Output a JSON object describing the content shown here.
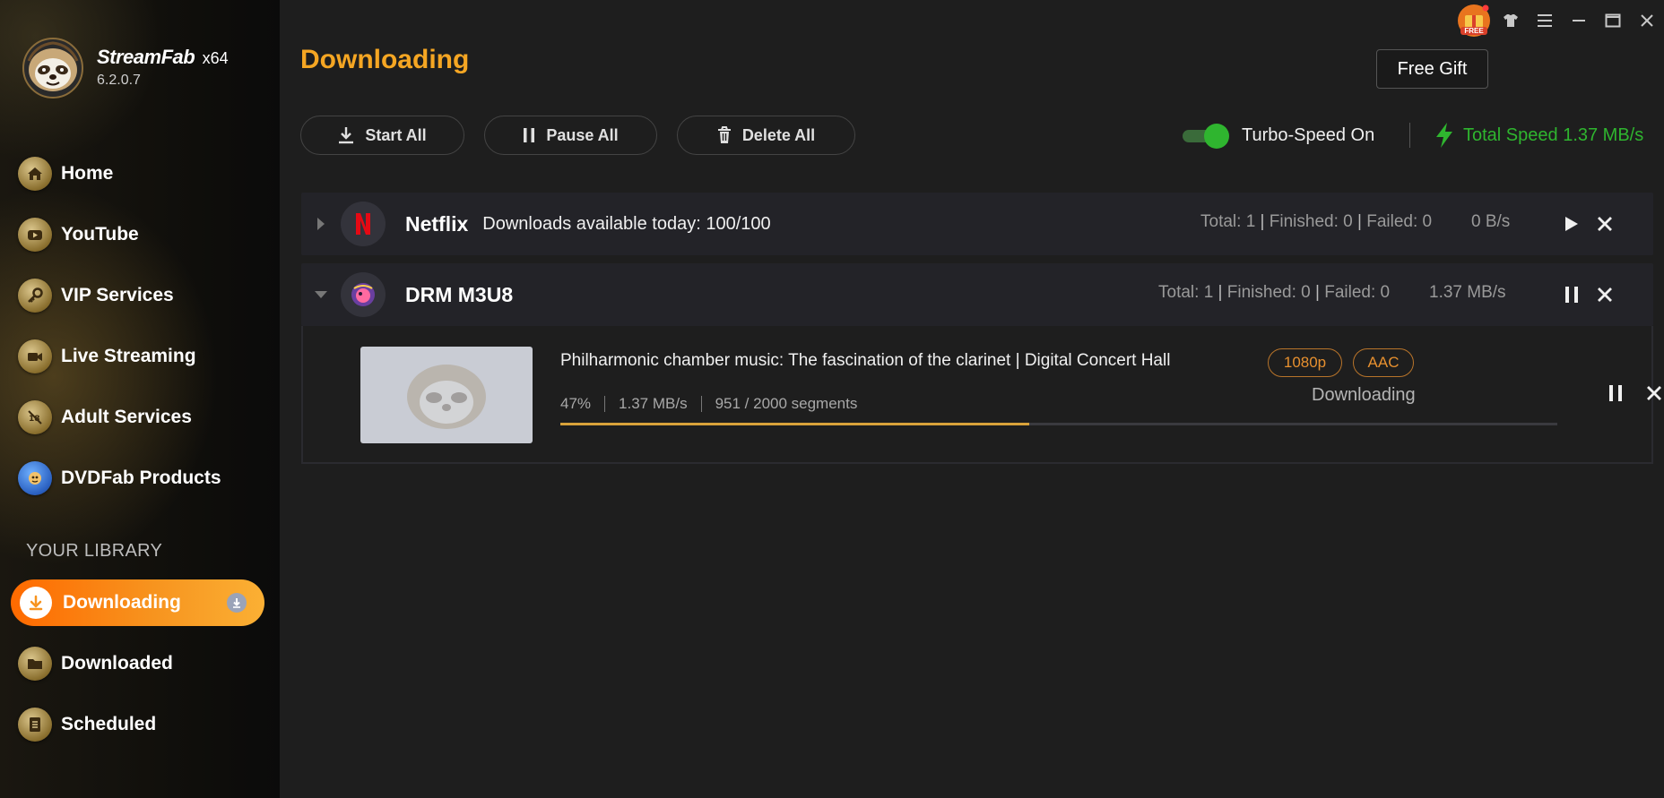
{
  "app": {
    "name": "StreamFab",
    "arch": "x64",
    "version": "6.2.0.7"
  },
  "window": {
    "free_gift_label": "Free Gift",
    "gift_badge_text": "FREE"
  },
  "sidebar": {
    "items": [
      {
        "label": "Home",
        "icon": "home-icon"
      },
      {
        "label": "YouTube",
        "icon": "youtube-icon"
      },
      {
        "label": "VIP Services",
        "icon": "key-icon"
      },
      {
        "label": "Live Streaming",
        "icon": "camera-icon"
      },
      {
        "label": "Adult Services",
        "icon": "adult-icon"
      },
      {
        "label": "DVDFab Products",
        "icon": "dvdfab-icon"
      }
    ],
    "library_label": "YOUR LIBRARY",
    "library": [
      {
        "label": "Downloading",
        "icon": "download-icon",
        "active": true
      },
      {
        "label": "Downloaded",
        "icon": "folder-icon"
      },
      {
        "label": "Scheduled",
        "icon": "list-icon"
      }
    ]
  },
  "main": {
    "title": "Downloading",
    "toolbar": {
      "start_all": "Start All",
      "pause_all": "Pause All",
      "delete_all": "Delete All"
    },
    "turbo_label": "Turbo-Speed On",
    "turbo_on": true,
    "total_speed": "Total Speed 1.37 MB/s"
  },
  "groups": [
    {
      "name": "Netflix",
      "availability": "Downloads available today: 100/100",
      "total": "Total: 1",
      "finished": "Finished: 0",
      "failed": "Failed: 0",
      "rate": "0 B/s",
      "expanded": false
    },
    {
      "name": "DRM M3U8",
      "total": "Total: 1",
      "finished": "Finished: 0",
      "failed": "Failed: 0",
      "rate": "1.37 MB/s",
      "expanded": true
    }
  ],
  "task": {
    "title": "Philharmonic chamber music: The fascination of the clarinet | Digital Concert Hall",
    "resolution": "1080p",
    "audio": "AAC",
    "percent_label": "47%",
    "speed": "1.37 MB/s",
    "segments": "951 / 2000 segments",
    "progress": 0.47,
    "status": "Downloading"
  },
  "colors": {
    "accent": "#f5a623",
    "turbo_green": "#2fb52f",
    "active_gradient_start": "#ff6a00",
    "active_gradient_end": "#fbb034",
    "netflix_red": "#e50914"
  }
}
